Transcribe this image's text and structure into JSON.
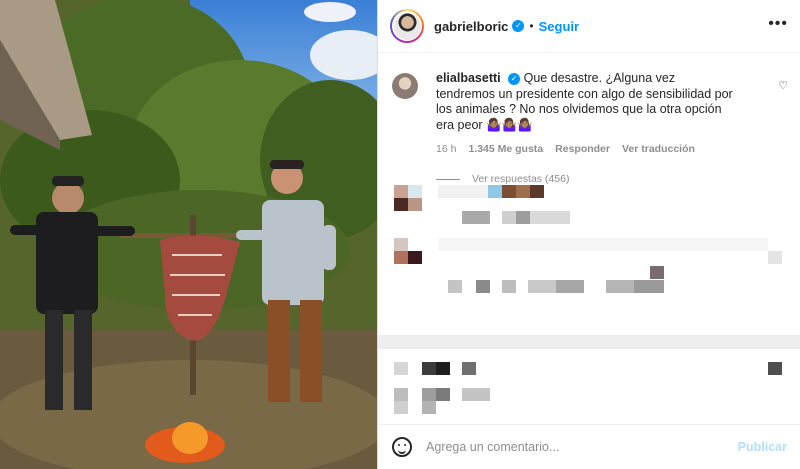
{
  "post": {
    "username": "gabrielboric",
    "follow_label": "Seguir",
    "separator": "•",
    "more_label": "•••",
    "verified_mark": "✓"
  },
  "comment": {
    "username": "elialbasetti",
    "text": "Que desastre. ¿Alguna vez tendremos un presidente con algo de sensibilidad por los animales ? No nos olvidemos que la otra opción era peor 🤷🏽‍♀️🤷🏽‍♀️🤷🏽‍♀️",
    "time": "16 h",
    "likes": "1.345 Me gusta",
    "reply_label": "Responder",
    "translate_label": "Ver traducción",
    "view_replies": "Ver respuestas (456)"
  },
  "footer": {
    "placeholder": "Agrega un comentario...",
    "publish_label": "Publicar"
  },
  "icons": {
    "like": "heart-icon",
    "emoji": "emoji-icon",
    "verified": "verified-badge-icon",
    "more": "more-options-icon"
  },
  "colors": {
    "accent": "#0095f6",
    "publish_disabled": "#b2dffc",
    "muted": "#8e8e8e"
  }
}
